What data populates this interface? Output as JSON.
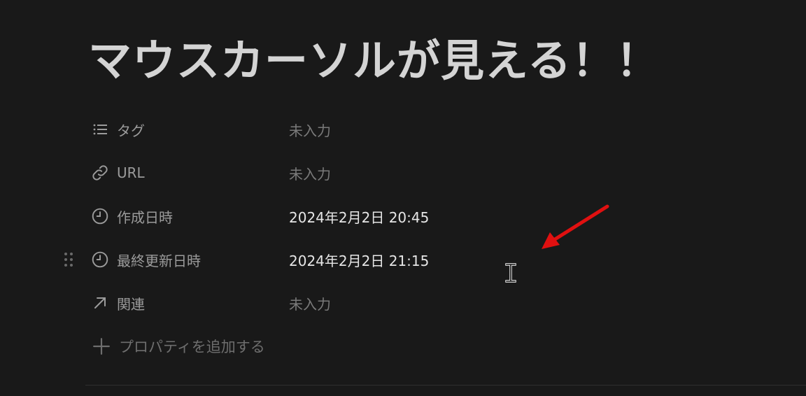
{
  "page": {
    "title": "マウスカーソルが見える！！"
  },
  "properties": [
    {
      "name": "タグ",
      "value": "未入力",
      "icon": "list-icon",
      "empty": true
    },
    {
      "name": "URL",
      "value": "未入力",
      "icon": "link-icon",
      "empty": true
    },
    {
      "name": "作成日時",
      "value": "2024年2月2日 20:45",
      "icon": "clock-icon",
      "empty": false
    },
    {
      "name": "最終更新日時",
      "value": "2024年2月2日 21:15",
      "icon": "clock-icon",
      "empty": false
    },
    {
      "name": "関連",
      "value": "未入力",
      "icon": "arrow-up-right-icon",
      "empty": true
    }
  ],
  "add_property": {
    "label": "プロパティを追加する",
    "icon": "plus-icon"
  },
  "colors": {
    "background": "#191919",
    "title": "#d4d4d4",
    "label": "#9b9b9b",
    "empty_value": "#7a7a7a",
    "value": "#e6e6e6",
    "annotation_arrow": "#e01010"
  }
}
